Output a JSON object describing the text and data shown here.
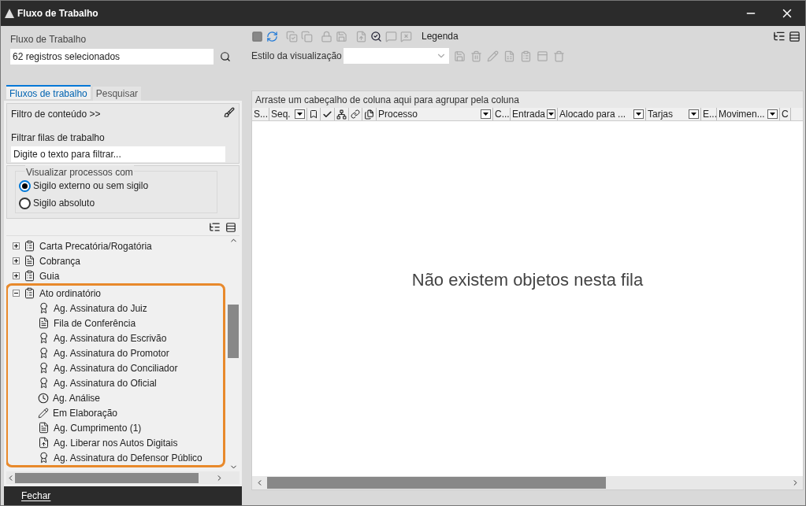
{
  "window": {
    "title": "Fluxo de Trabalho"
  },
  "left": {
    "workflow_label": "Fluxo de Trabalho",
    "workflow_value": "62 registros selecionados",
    "tabs": [
      {
        "label": "Fluxos de trabalho",
        "selected": true
      },
      {
        "label": "Pesquisar",
        "selected": false
      }
    ],
    "content_filter": "Filtro de conteúdo >>",
    "queue_filter_label": "Filtrar filas de trabalho",
    "queue_filter_placeholder": "Digite o texto para filtrar...",
    "visibility_group": "Visualizar processos com",
    "radios": [
      {
        "label": "Sigilo externo ou sem sigilo",
        "selected": true
      },
      {
        "label": "Sigilo absoluto",
        "selected": false
      }
    ],
    "tree": [
      {
        "label": "Carta Precatória/Rogatória",
        "kind": "clipboard",
        "expanded": false,
        "highlighted": false
      },
      {
        "label": "Cobrança",
        "kind": "doc",
        "expanded": false,
        "highlighted": false
      },
      {
        "label": "Guia",
        "kind": "clipboard",
        "expanded": false,
        "highlighted": false
      },
      {
        "label": "Ato ordinatório",
        "kind": "clipboard",
        "expanded": true,
        "highlighted": true,
        "children": [
          {
            "label": "Ag. Assinatura do Juiz",
            "kind": "seal"
          },
          {
            "label": "Fila de Conferência",
            "kind": "doc"
          },
          {
            "label": "Ag. Assinatura do Escrivão",
            "kind": "seal"
          },
          {
            "label": "Ag. Assinatura do Promotor",
            "kind": "seal"
          },
          {
            "label": "Ag. Assinatura do Conciliador",
            "kind": "seal"
          },
          {
            "label": "Ag. Assinatura do Oficial",
            "kind": "seal"
          },
          {
            "label": "Ag. Análise",
            "kind": "clock"
          },
          {
            "label": "Em Elaboração",
            "kind": "pen"
          },
          {
            "label": "Ag. Cumprimento (1)",
            "kind": "doc"
          },
          {
            "label": "Ag. Liberar nos Autos Digitais",
            "kind": "upload"
          },
          {
            "label": "Ag. Assinatura do Defensor Público",
            "kind": "seal"
          }
        ]
      }
    ],
    "close_button": "Fechar"
  },
  "right": {
    "legend": "Legenda",
    "view_style_label": "Estilo da visualização",
    "group_hint": "Arraste um cabeçalho de coluna aqui para agrupar pela coluna",
    "columns": [
      {
        "kind": "text",
        "label": "S...",
        "filter": false
      },
      {
        "kind": "text",
        "label": "Seq.",
        "filter": true
      },
      {
        "kind": "bookmark"
      },
      {
        "kind": "check"
      },
      {
        "kind": "tree"
      },
      {
        "kind": "link"
      },
      {
        "kind": "pages"
      },
      {
        "kind": "text",
        "label": "Processo",
        "filter": true
      },
      {
        "kind": "text",
        "label": "C...",
        "filter": false
      },
      {
        "kind": "text",
        "label": "Entrada",
        "filter": true
      },
      {
        "kind": "text",
        "label": "Alocado para ...",
        "filter": true
      },
      {
        "kind": "text",
        "label": "Tarjas",
        "filter": true
      },
      {
        "kind": "text",
        "label": "E...",
        "filter": false
      },
      {
        "kind": "text",
        "label": "Movimen...",
        "filter": true
      },
      {
        "kind": "text",
        "label": "C",
        "filter": false
      }
    ],
    "empty_message": "Não existem objetos nesta fila"
  }
}
